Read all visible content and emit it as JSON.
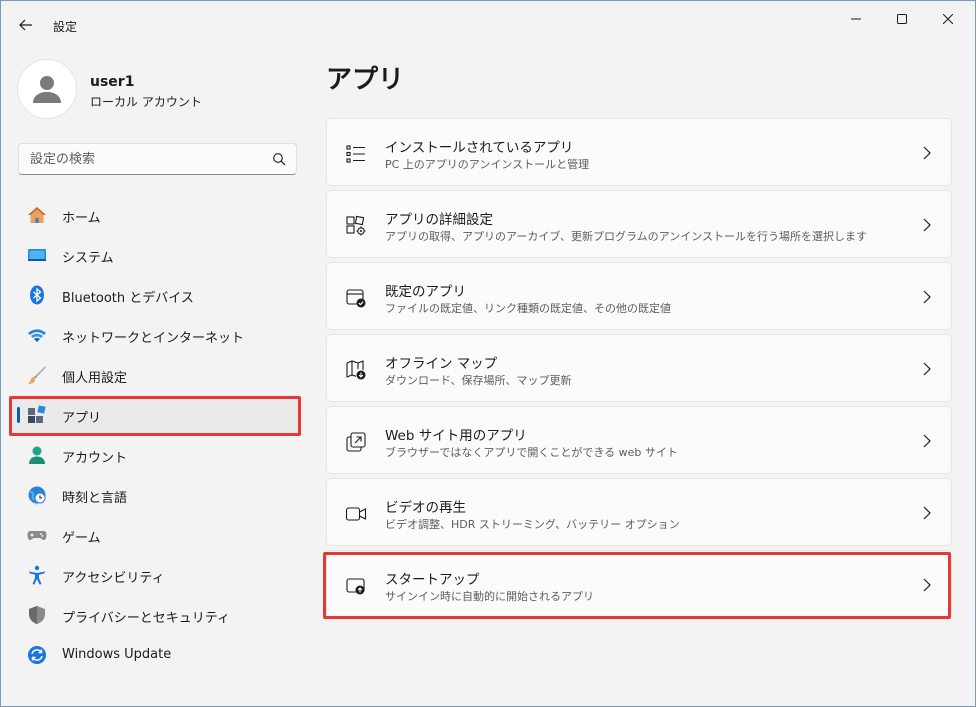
{
  "window": {
    "title": "設定"
  },
  "profile": {
    "name": "user1",
    "account_type": "ローカル アカウント"
  },
  "search": {
    "placeholder": "設定の検索"
  },
  "sidebar": {
    "items": [
      {
        "label": "ホーム",
        "icon": "home-icon"
      },
      {
        "label": "システム",
        "icon": "system-icon"
      },
      {
        "label": "Bluetooth とデバイス",
        "icon": "bluetooth-icon"
      },
      {
        "label": "ネットワークとインターネット",
        "icon": "wifi-icon"
      },
      {
        "label": "個人用設定",
        "icon": "brush-icon"
      },
      {
        "label": "アプリ",
        "icon": "apps-icon",
        "selected": true
      },
      {
        "label": "アカウント",
        "icon": "account-icon"
      },
      {
        "label": "時刻と言語",
        "icon": "time-language-icon"
      },
      {
        "label": "ゲーム",
        "icon": "gamepad-icon"
      },
      {
        "label": "アクセシビリティ",
        "icon": "accessibility-icon"
      },
      {
        "label": "プライバシーとセキュリティ",
        "icon": "shield-icon"
      },
      {
        "label": "Windows Update",
        "icon": "update-icon"
      }
    ]
  },
  "main": {
    "title": "アプリ",
    "cards": [
      {
        "title": "インストールされているアプリ",
        "desc": "PC 上のアプリのアンインストールと管理",
        "icon": "list-icon"
      },
      {
        "title": "アプリの詳細設定",
        "desc": "アプリの取得、アプリのアーカイブ、更新プログラムのアンインストールを行う場所を選択します",
        "icon": "app-settings-icon"
      },
      {
        "title": "既定のアプリ",
        "desc": "ファイルの既定値、リンク種類の既定値、その他の既定値",
        "icon": "default-apps-icon"
      },
      {
        "title": "オフライン マップ",
        "desc": "ダウンロード、保存場所、マップ更新",
        "icon": "map-icon"
      },
      {
        "title": "Web サイト用のアプリ",
        "desc": "ブラウザーではなくアプリで開くことができる web サイト",
        "icon": "open-link-icon"
      },
      {
        "title": "ビデオの再生",
        "desc": "ビデオ調整、HDR ストリーミング、バッテリー オプション",
        "icon": "video-icon"
      },
      {
        "title": "スタートアップ",
        "desc": "サインイン時に自動的に開始されるアプリ",
        "icon": "startup-icon"
      }
    ]
  },
  "colors": {
    "accent": "#005fb8",
    "highlight": "#e53935"
  }
}
